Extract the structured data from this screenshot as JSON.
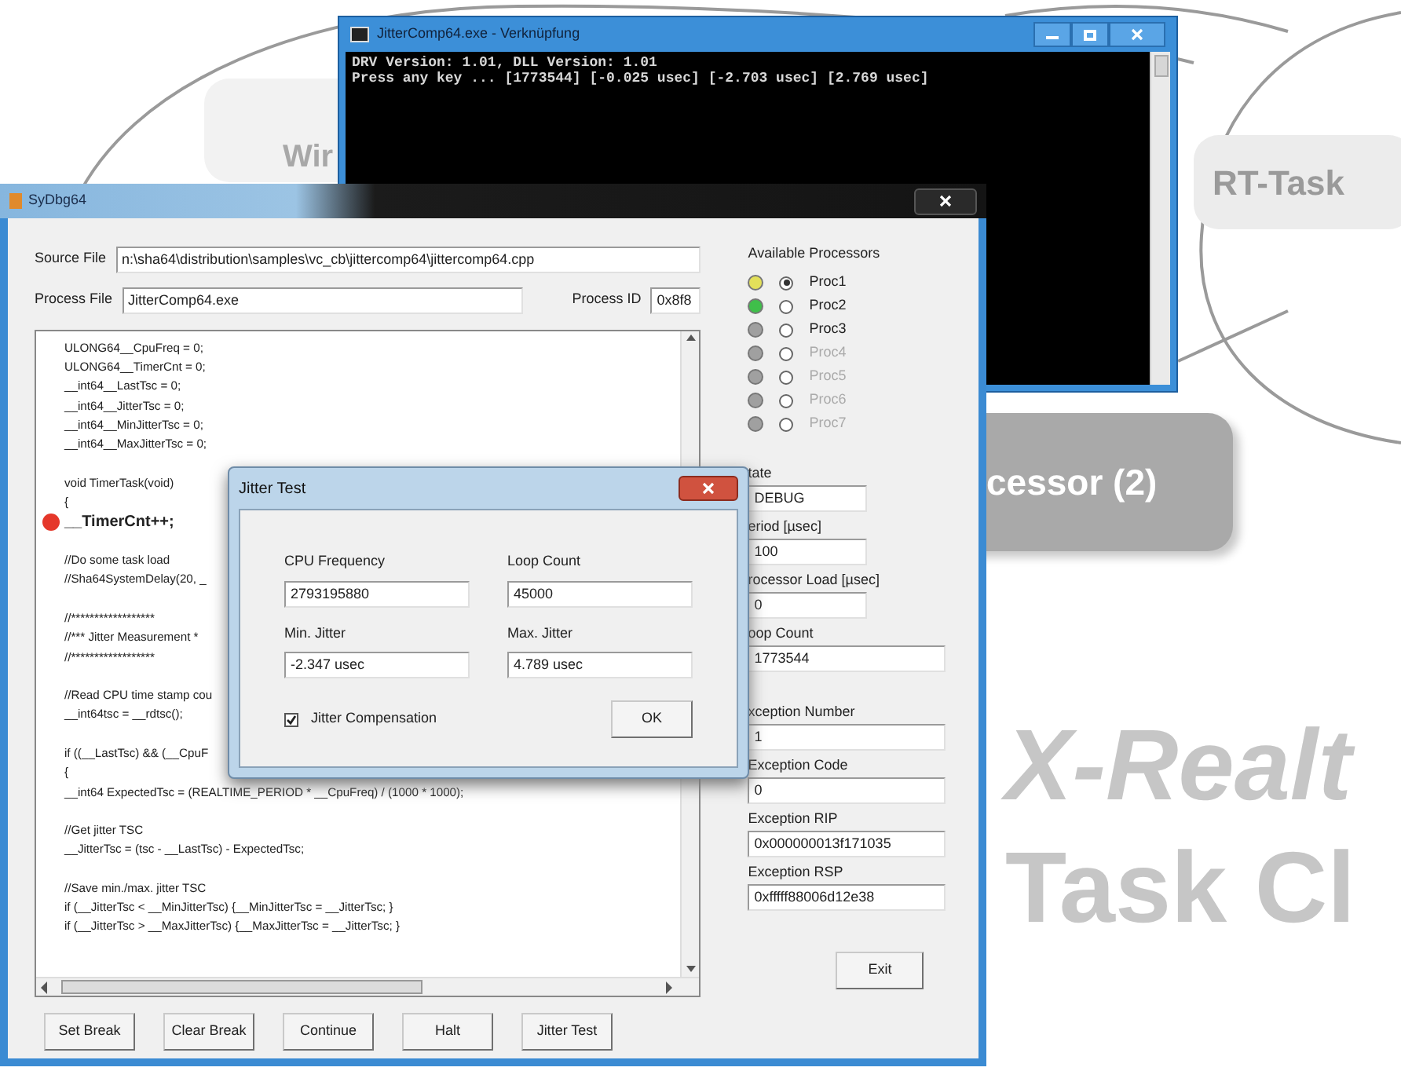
{
  "background": {
    "labels": [
      {
        "kind": "faded",
        "text": "Wir"
      },
      {
        "kind": "pill",
        "text": "RT-Task"
      },
      {
        "kind": "dark",
        "text": "cessor (2)"
      }
    ],
    "headline": [
      "X-Realt",
      "Task Cl"
    ]
  },
  "console": {
    "title": "JitterComp64.exe - Verknüpfung",
    "lines": [
      "DRV Version: 1.01, DLL Version: 1.01",
      "Press any key ... [1773544] [-0.025 usec] [-2.703 usec] [2.769 usec]"
    ]
  },
  "debugger": {
    "title": "SyDbg64",
    "source_file": {
      "label": "Source File",
      "value": "n:\\sha64\\distribution\\samples\\vc_cb\\jittercomp64\\jittercomp64.cpp"
    },
    "process_file": {
      "label": "Process File",
      "value": "JitterComp64.exe"
    },
    "process_id": {
      "label": "Process ID",
      "value": "0x8f8"
    },
    "code": [
      [
        {
          "text": "ULONG64__CpuFreq = 0;",
          "breakpoint": false
        },
        {
          "text": "ULONG64__TimerCnt = 0;",
          "breakpoint": false
        },
        {
          "text": "__int64__LastTsc = 0;",
          "breakpoint": false
        },
        {
          "text": "__int64__JitterTsc = 0;",
          "breakpoint": false
        },
        {
          "text": "__int64__MinJitterTsc = 0;",
          "breakpoint": false
        },
        {
          "text": "__int64__MaxJitterTsc = 0;",
          "breakpoint": false
        }
      ],
      [
        {
          "text": "void TimerTask(void)",
          "breakpoint": false
        },
        {
          "text": "{",
          "breakpoint": false
        },
        {
          "text": "__TimerCnt++;",
          "breakpoint": true
        }
      ],
      [
        {
          "text": "//Do some task load",
          "breakpoint": false
        },
        {
          "text": "//Sha64SystemDelay(20, _",
          "breakpoint": false
        }
      ],
      [
        {
          "text": "//******************",
          "breakpoint": false
        },
        {
          "text": "//*** Jitter Measurement *",
          "breakpoint": false
        },
        {
          "text": "//******************",
          "breakpoint": false
        }
      ],
      [
        {
          "text": "//Read CPU time stamp cou",
          "breakpoint": false
        },
        {
          "text": "__int64tsc = __rdtsc();",
          "breakpoint": false
        }
      ],
      [
        {
          "text": "if ((__LastTsc) && (__CpuF",
          "breakpoint": false
        },
        {
          "text": "{",
          "breakpoint": false
        },
        {
          "text": "__int64 ExpectedTsc = (REALTIME_PERIOD * __CpuFreq) / (1000 * 1000);",
          "breakpoint": false
        }
      ],
      [
        {
          "text": "//Get jitter TSC",
          "breakpoint": false
        },
        {
          "text": "__JitterTsc = (tsc - __LastTsc) - ExpectedTsc;",
          "breakpoint": false
        }
      ],
      [
        {
          "text": "//Save min./max. jitter TSC",
          "breakpoint": false
        },
        {
          "text": "if (__JitterTsc < __MinJitterTsc) {__MinJitterTsc = __JitterTsc; }",
          "breakpoint": false
        },
        {
          "text": "if (__JitterTsc > __MaxJitterTsc) {__MaxJitterTsc = __JitterTsc; }",
          "breakpoint": false
        }
      ]
    ],
    "processors": {
      "label": "Available Processors",
      "items": [
        {
          "label": "Proc1",
          "color": "#e3e05a",
          "selected": true,
          "disabled": false
        },
        {
          "label": "Proc2",
          "color": "#3fbf4a",
          "selected": false,
          "disabled": false
        },
        {
          "label": "Proc3",
          "color": "#a0a0a0",
          "selected": false,
          "disabled": false
        },
        {
          "label": "Proc4",
          "color": "#a0a0a0",
          "selected": false,
          "disabled": true
        },
        {
          "label": "Proc5",
          "color": "#a0a0a0",
          "selected": false,
          "disabled": true
        },
        {
          "label": "Proc6",
          "color": "#a0a0a0",
          "selected": false,
          "disabled": true
        },
        {
          "label": "Proc7",
          "color": "#a0a0a0",
          "selected": false,
          "disabled": true
        }
      ]
    },
    "fields": [
      {
        "label": "tate",
        "value": "DEBUG",
        "kind": "short"
      },
      {
        "label": "eriod [µsec]",
        "value": "100",
        "kind": "short"
      },
      {
        "label": "rocessor Load [µsec]",
        "value": "0",
        "kind": "short"
      },
      {
        "label": "oop Count",
        "value": "1773544",
        "kind": "long"
      },
      {
        "label": "xception Number",
        "value": "1",
        "kind": "long"
      },
      {
        "label": "Exception Code",
        "value": "0",
        "kind": "long"
      },
      {
        "label": "Exception RIP",
        "value": "0x000000013f171035",
        "kind": "long"
      },
      {
        "label": "Exception RSP",
        "value": "0xfffff88006d12e38",
        "kind": "long"
      }
    ],
    "buttons": [
      "Set Break",
      "Clear Break",
      "Continue",
      "Halt",
      "Jitter Test"
    ],
    "exit_button": "Exit"
  },
  "dialog": {
    "title": "Jitter Test",
    "fields": [
      {
        "label": "CPU Frequency",
        "value": "2793195880"
      },
      {
        "label": "Loop Count",
        "value": "45000"
      },
      {
        "label": "Min. Jitter",
        "value": "-2.347 usec"
      },
      {
        "label": "Max. Jitter",
        "value": "4.789 usec"
      }
    ],
    "checkbox": {
      "label": "Jitter Compensation",
      "checked": true
    },
    "ok_button": "OK"
  }
}
